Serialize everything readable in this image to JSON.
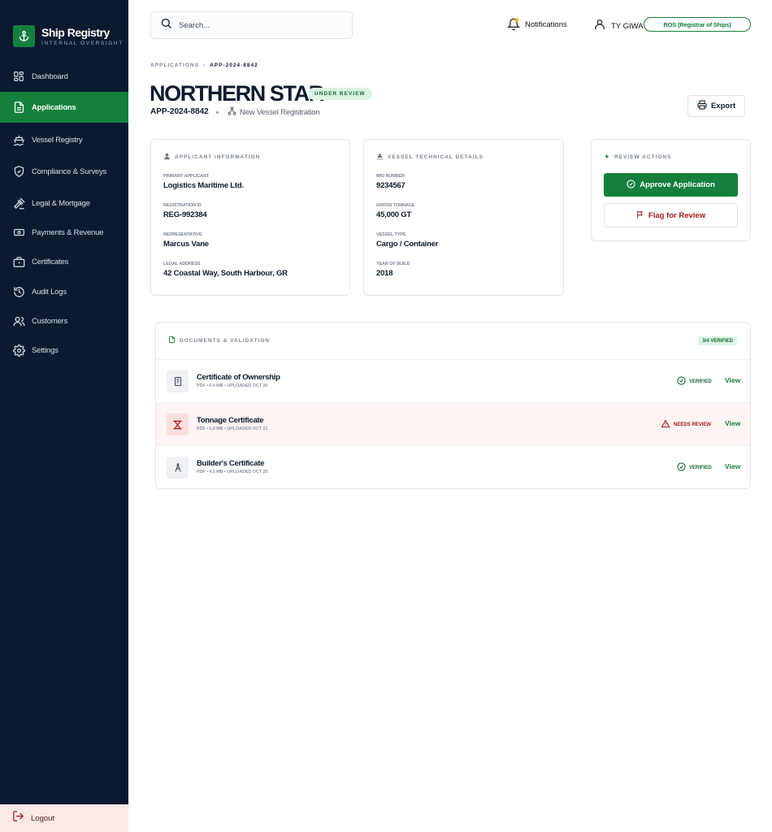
{
  "brand": {
    "title": "Ship Registry",
    "subtitle": "INTERNAL OVERSIGHT"
  },
  "sidebar": {
    "items": [
      {
        "label": "Dashboard",
        "icon": "grid-icon"
      },
      {
        "label": "Applications",
        "icon": "document-icon",
        "active": true
      },
      {
        "label": "Vessel Registry",
        "icon": "ship-icon"
      },
      {
        "label": "Compliance & Surveys",
        "icon": "shield-icon"
      },
      {
        "label": "Legal & Mortgage",
        "icon": "gavel-icon"
      },
      {
        "label": "Payments & Revenue",
        "icon": "banknote-icon"
      },
      {
        "label": "Certificates",
        "icon": "briefcase-icon"
      },
      {
        "label": "Audit Logs",
        "icon": "history-icon"
      },
      {
        "label": "Customers",
        "icon": "users-icon"
      },
      {
        "label": "Settings",
        "icon": "gear-icon"
      }
    ],
    "logout": "Logout"
  },
  "topbar": {
    "search_placeholder": "Search...",
    "notifications": "Notifications",
    "user_name": "TY GIWA",
    "role": "ROS (Registrar of Ships)"
  },
  "header": {
    "breadcrumb": [
      "APPLICATIONS",
      "APP-2024-8842"
    ],
    "title": "NORTHERN STAR",
    "status": "UNDER REVIEW",
    "app_id": "APP-2024-8842",
    "app_type": "New Vessel Registration",
    "export": "Export"
  },
  "applicant": {
    "heading": "APPLICANT INFORMATION",
    "fields": [
      {
        "label": "PRIMARY APPLICANT",
        "value": "Logistics Maritime Ltd."
      },
      {
        "label": "REGISTRATION ID",
        "value": "REG-992384"
      },
      {
        "label": "REPRESENTATIVE",
        "value": "Marcus Vane"
      },
      {
        "label": "LEGAL ADDRESS",
        "value": "42 Coastal Way, South Harbour, GR"
      }
    ]
  },
  "vessel": {
    "heading": "VESSEL TECHNICAL DETAILS",
    "fields": [
      {
        "label": "IMO NUMBER",
        "value": "9234567"
      },
      {
        "label": "GROSS TONNAGE",
        "value": "45,000 GT"
      },
      {
        "label": "VESSEL TYPE",
        "value": "Cargo / Container"
      },
      {
        "label": "YEAR OF BUILD",
        "value": "2018"
      }
    ]
  },
  "review": {
    "heading": "REVIEW ACTIONS",
    "approve": "Approve Application",
    "flag": "Flag for Review"
  },
  "documents": {
    "heading": "DOCUMENTS & VALIDATION",
    "badge": "3/4 VERIFIED",
    "view_label": "View",
    "items": [
      {
        "name": "Certificate of Ownership",
        "meta": "PDF • 2.4 MB • UPLOADED OCT 20",
        "status": "VERIFIED",
        "state": "ok"
      },
      {
        "name": "Tonnage Certificate",
        "meta": "PDF • 1.8 MB • UPLOADED OCT 21",
        "status": "NEEDS REVIEW",
        "state": "bad"
      },
      {
        "name": "Builder's Certificate",
        "meta": "PDF • 4.1 MB • UPLOADED OCT 20",
        "status": "VERIFIED",
        "state": "ok"
      }
    ]
  },
  "colors": {
    "sidebar_bg": "#0c1a30",
    "accent": "#15803d",
    "danger": "#a11a1a",
    "warn_row": "#fdf4f3"
  }
}
